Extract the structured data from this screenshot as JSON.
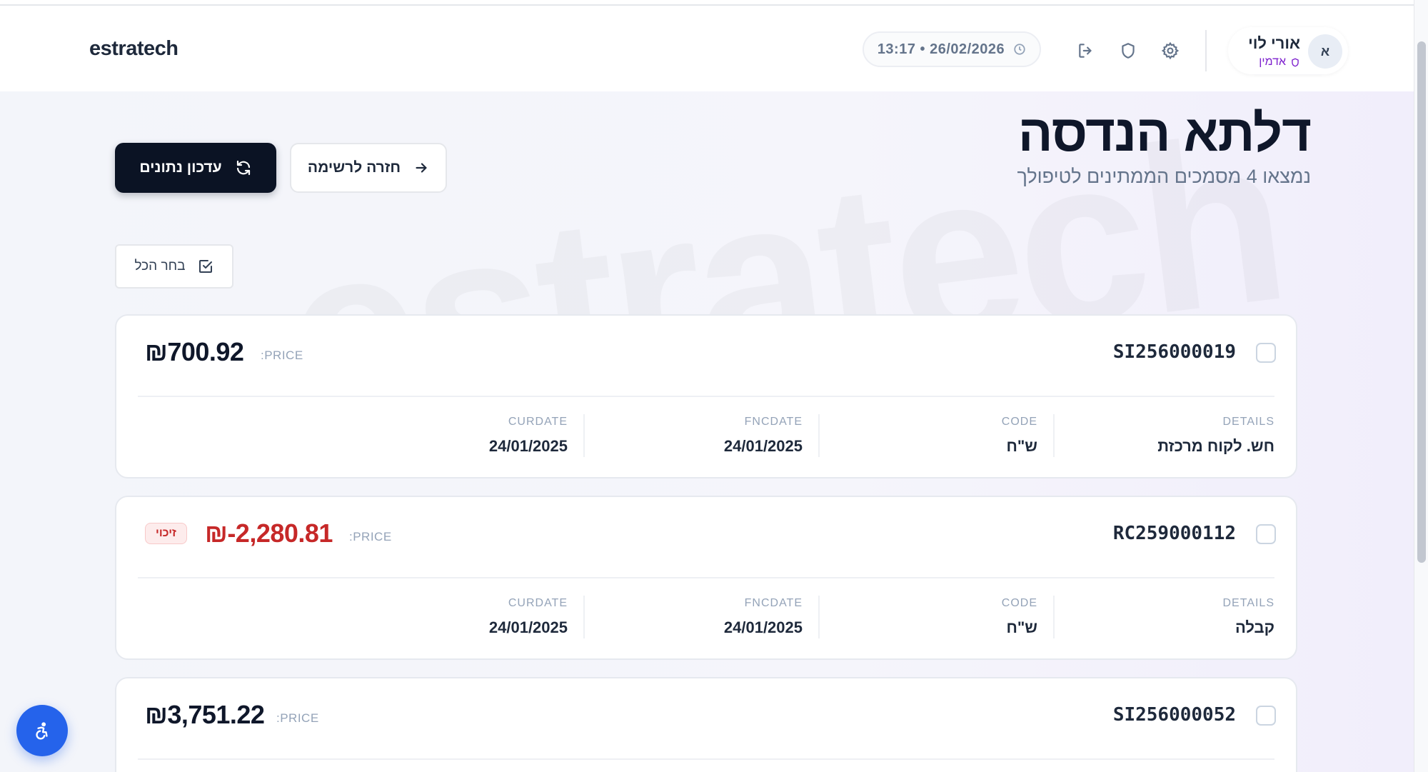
{
  "header": {
    "logo": "estratech",
    "datetime": "13:17 • 26/02/2026",
    "user": {
      "name": "אורי לוי",
      "role": "אדמין",
      "initial": "א"
    },
    "icons": [
      "logout-icon",
      "shield-icon",
      "gear-icon",
      "clock-icon"
    ]
  },
  "page": {
    "watermark": "estratech",
    "title": "דלתא הנדסה",
    "subtitle": "נמצאו 4 מסמכים הממתינים לטיפולך"
  },
  "actions": {
    "refresh_label": "עדכון נתונים",
    "back_label": "חזרה לרשימה",
    "select_all_label": "בחר הכל"
  },
  "labels": {
    "price": ":PRICE",
    "details": "DETAILS",
    "code": "CODE",
    "fncdate": "FNCDATE",
    "curdate": "CURDATE"
  },
  "documents": [
    {
      "doc_no": "SI256000019",
      "price": "₪700.92",
      "details": "חש. לקוח מרכזת",
      "code": "ש\"ח",
      "fncdate": "24/01/2025",
      "curdate": "24/01/2025"
    },
    {
      "doc_no": "RC259000112",
      "price": "₪-2,280.81",
      "badge": "זיכוי",
      "details": "קבלה",
      "code": "ש\"ח",
      "fncdate": "24/01/2025",
      "curdate": "24/01/2025"
    },
    {
      "doc_no": "SI256000052",
      "price": "₪3,751.22"
    }
  ],
  "colors": {
    "primary_dark": "#0b1324",
    "negative": "#c62828",
    "role_purple": "#7e22ce",
    "accessibility_blue": "#2563eb"
  }
}
